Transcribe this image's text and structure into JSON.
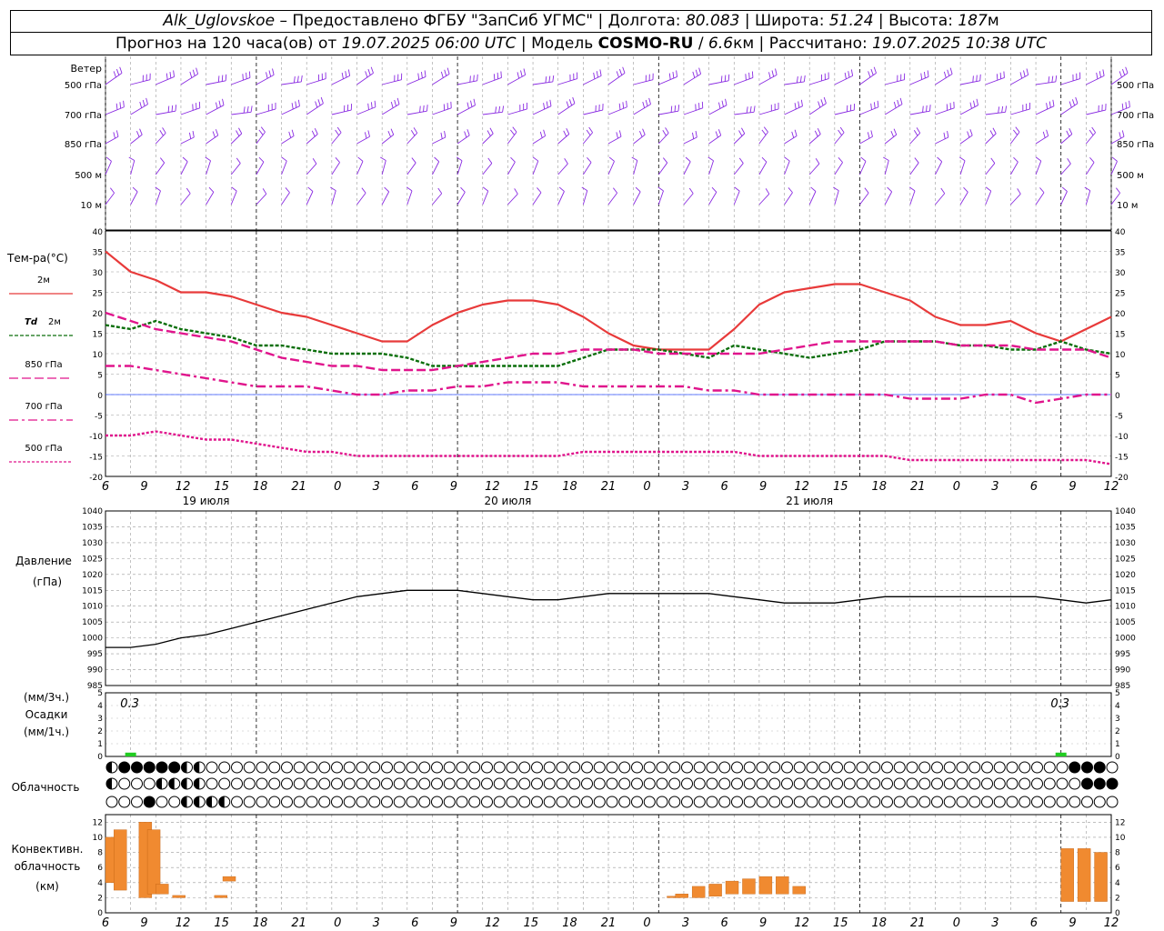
{
  "header": {
    "station": "Alk_Uglovskoe",
    "dash": " – ",
    "provided": "Предоставлено ФГБУ \"ЗапСиб УГМС\"",
    "lon_label": "Долгота:",
    "lon_value": "80.083",
    "lat_label": "Широта:",
    "lat_value": "51.24",
    "alt_label": "Высота:",
    "alt_value": "187",
    "alt_unit": "м",
    "sep": " | ",
    "forecast_label": "Прогноз на 120 часа(ов) от",
    "forecast_from": "19.07.2025 06:00 UTC",
    "model_label": "Модель",
    "model_name": "COSMO-RU",
    "model_slash": " / ",
    "model_res": "6.6",
    "model_res_unit": "км",
    "calc_label": "Рассчитано:",
    "calc_time": "19.07.2025 10:38 UTC"
  },
  "axes": {
    "hour_labels": [
      "6",
      "9",
      "12",
      "15",
      "18",
      "21",
      "0",
      "3",
      "6",
      "9",
      "12",
      "15",
      "18",
      "21",
      "0",
      "3",
      "6",
      "9",
      "12",
      "15",
      "18",
      "21",
      "0",
      "3",
      "6",
      "9",
      "12"
    ],
    "date_labels": [
      "19 июля",
      "20 июля",
      "21 июля"
    ]
  },
  "wind": {
    "title": "Ветер",
    "levels": [
      "500 гПа",
      "700 гПа",
      "850 гПа",
      "500 м",
      "10 м"
    ]
  },
  "temp": {
    "title": "Тем-ра(°C)",
    "legend": [
      {
        "label": "2м",
        "color": "#e83a3a"
      },
      {
        "label": "Td",
        "label2": "2м",
        "color": "#0a6e0a"
      },
      {
        "label": "850 гПа",
        "color": "#e0148c"
      },
      {
        "label": "700 гПа",
        "color": "#e0148c"
      },
      {
        "label": "500 гПа",
        "color": "#e0148c"
      }
    ],
    "ticks": [
      "40",
      "35",
      "30",
      "25",
      "20",
      "15",
      "10",
      "5",
      "0",
      "-5",
      "-10",
      "-15",
      "-20"
    ]
  },
  "pressure": {
    "title": "Давление",
    "unit": "(гПа)",
    "ticks": [
      "1040",
      "1035",
      "1030",
      "1025",
      "1020",
      "1015",
      "1010",
      "1005",
      "1000",
      "995",
      "990",
      "985"
    ]
  },
  "precip": {
    "unit_3h": "(мм/3ч.)",
    "title": "Осадки",
    "unit_1h": "(мм/1ч.)",
    "ticks": [
      "5",
      "4",
      "3",
      "2",
      "1",
      "0"
    ],
    "annotations": [
      "0.3",
      "0.3"
    ],
    "color": "#22cc22"
  },
  "clouds": {
    "title": "Облачность"
  },
  "convective": {
    "title1": "Конвективн.",
    "title2": "облачность",
    "unit": "(км)",
    "ticks": [
      "12",
      "10",
      "8",
      "6",
      "4",
      "2",
      "0"
    ],
    "color": "#f08a30"
  },
  "chart_data": [
    {
      "type": "line",
      "title": "Тем-ра(°C)",
      "x_hours_from_start": [
        0,
        3,
        6,
        9,
        12,
        15,
        18,
        21,
        24,
        27,
        30,
        33,
        36,
        39,
        42,
        45,
        48,
        51,
        54,
        57,
        60,
        63,
        66,
        69,
        72,
        75,
        78,
        81,
        84,
        87,
        90,
        93,
        96,
        99,
        102,
        105,
        108,
        111,
        114,
        117,
        120
      ],
      "ylim": [
        -20,
        40
      ],
      "series": [
        {
          "name": "2м",
          "values": [
            35,
            30,
            28,
            25,
            25,
            24,
            22,
            20,
            19,
            17,
            15,
            13,
            13,
            17,
            20,
            22,
            23,
            23,
            22,
            19,
            15,
            12,
            11,
            11,
            11,
            16,
            22,
            25,
            26,
            27,
            27,
            25,
            23,
            19,
            17,
            17,
            18,
            15,
            13,
            16,
            19
          ]
        },
        {
          "name": "Td 2м",
          "values": [
            17,
            16,
            18,
            16,
            15,
            14,
            12,
            12,
            11,
            10,
            10,
            10,
            9,
            7,
            7,
            7,
            7,
            7,
            7,
            9,
            11,
            11,
            11,
            10,
            9,
            12,
            11,
            10,
            9,
            10,
            11,
            13,
            13,
            13,
            12,
            12,
            11,
            11,
            13,
            11,
            10
          ]
        },
        {
          "name": "850 гПа",
          "values": [
            20,
            18,
            16,
            15,
            14,
            13,
            11,
            9,
            8,
            7,
            7,
            6,
            6,
            6,
            7,
            8,
            9,
            10,
            10,
            11,
            11,
            11,
            10,
            10,
            10,
            10,
            10,
            11,
            12,
            13,
            13,
            13,
            13,
            13,
            12,
            12,
            12,
            11,
            11,
            11,
            9
          ]
        },
        {
          "name": "700 гПа",
          "values": [
            7,
            7,
            6,
            5,
            4,
            3,
            2,
            2,
            2,
            1,
            0,
            0,
            1,
            1,
            2,
            2,
            3,
            3,
            3,
            2,
            2,
            2,
            2,
            2,
            1,
            1,
            0,
            0,
            0,
            0,
            0,
            0,
            -1,
            -1,
            -1,
            0,
            0,
            -2,
            -1,
            0,
            0
          ]
        },
        {
          "name": "500 гПа",
          "values": [
            -10,
            -10,
            -9,
            -10,
            -11,
            -11,
            -12,
            -13,
            -14,
            -14,
            -15,
            -15,
            -15,
            -15,
            -15,
            -15,
            -15,
            -15,
            -15,
            -14,
            -14,
            -14,
            -14,
            -14,
            -14,
            -14,
            -15,
            -15,
            -15,
            -15,
            -15,
            -15,
            -16,
            -16,
            -16,
            -16,
            -16,
            -16,
            -16,
            -16,
            -17
          ]
        }
      ]
    },
    {
      "type": "line",
      "title": "Давление",
      "x_hours_from_start": [
        0,
        3,
        6,
        9,
        12,
        15,
        18,
        21,
        24,
        27,
        30,
        33,
        36,
        39,
        42,
        45,
        48,
        51,
        54,
        57,
        60,
        63,
        66,
        69,
        72,
        75,
        78,
        81,
        84,
        87,
        90,
        93,
        96,
        99,
        102,
        105,
        108,
        111,
        114,
        117,
        120
      ],
      "ylim": [
        985,
        1040
      ],
      "series": [
        {
          "name": "",
          "values": [
            997,
            997,
            998,
            1000,
            1001,
            1003,
            1005,
            1007,
            1009,
            1011,
            1013,
            1014,
            1015,
            1015,
            1015,
            1014,
            1013,
            1012,
            1012,
            1013,
            1014,
            1014,
            1014,
            1014,
            1014,
            1013,
            1012,
            1011,
            1011,
            1011,
            1012,
            1013,
            1013,
            1013,
            1013,
            1013,
            1013,
            1013,
            1012,
            1011,
            1012
          ]
        }
      ]
    },
    {
      "type": "bar",
      "title": "Осадки",
      "x_hours_from_start": [
        3,
        114
      ],
      "values": [
        0.3,
        0.3
      ],
      "ylim": [
        0,
        5
      ]
    },
    {
      "type": "bar",
      "title": "Конвективн. облачность",
      "bars_km": [
        {
          "x": 0,
          "bottom": 4,
          "top": 10
        },
        {
          "x": 1,
          "bottom": 3,
          "top": 11
        },
        {
          "x": 4,
          "bottom": 2,
          "top": 12
        },
        {
          "x": 5,
          "bottom": 2.5,
          "top": 11
        },
        {
          "x": 6,
          "bottom": 2.5,
          "top": 3.8
        },
        {
          "x": 8,
          "bottom": 2,
          "top": 2.3
        },
        {
          "x": 13,
          "bottom": 2,
          "top": 2.3
        },
        {
          "x": 14,
          "bottom": 4.2,
          "top": 4.8
        },
        {
          "x": 67,
          "bottom": 2,
          "top": 2.2
        },
        {
          "x": 68,
          "bottom": 2,
          "top": 2.5
        },
        {
          "x": 70,
          "bottom": 2,
          "top": 3.5
        },
        {
          "x": 72,
          "bottom": 2.2,
          "top": 3.8
        },
        {
          "x": 74,
          "bottom": 2.5,
          "top": 4.2
        },
        {
          "x": 76,
          "bottom": 2.5,
          "top": 4.5
        },
        {
          "x": 78,
          "bottom": 2.5,
          "top": 4.8
        },
        {
          "x": 80,
          "bottom": 2.5,
          "top": 4.8
        },
        {
          "x": 82,
          "bottom": 2.5,
          "top": 3.5
        },
        {
          "x": 114,
          "bottom": 1.5,
          "top": 8.5
        },
        {
          "x": 116,
          "bottom": 1.5,
          "top": 8.5
        },
        {
          "x": 118,
          "bottom": 1.5,
          "top": 8
        }
      ],
      "ylim": [
        0,
        13
      ]
    }
  ]
}
